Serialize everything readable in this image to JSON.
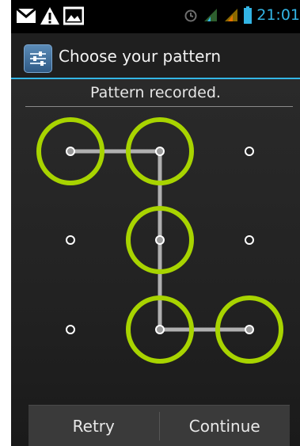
{
  "status_bar": {
    "time": "21:01",
    "icons": [
      "gmail-icon",
      "alert-icon",
      "image-icon",
      "alarm-icon",
      "signal-icon",
      "signal-icon",
      "battery-icon"
    ]
  },
  "title_bar": {
    "title": "Choose your pattern",
    "icon": "settings-app-icon"
  },
  "message": "Pattern recorded.",
  "pattern": {
    "grid_size": 3,
    "selected_sequence": [
      [
        0,
        0
      ],
      [
        1,
        0
      ],
      [
        1,
        1
      ],
      [
        1,
        2
      ],
      [
        2,
        2
      ]
    ],
    "colors": {
      "ring": "#a8d400",
      "line": "#b0b0b0",
      "dot": "#ffffff"
    }
  },
  "buttons": {
    "retry": "Retry",
    "continue": "Continue"
  },
  "colors": {
    "accent": "#33b5e5"
  }
}
